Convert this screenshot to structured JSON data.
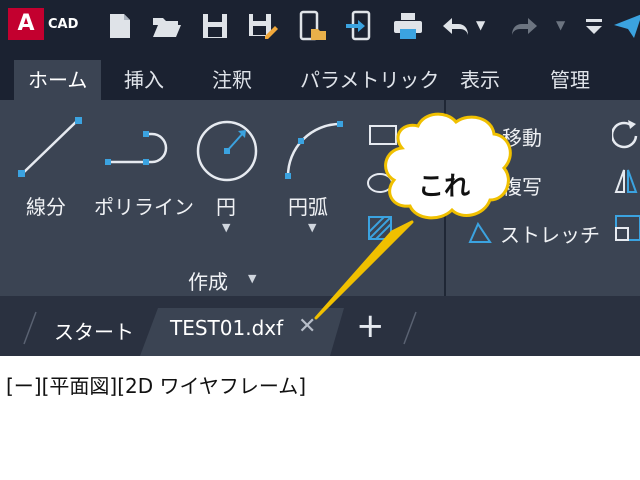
{
  "app": {
    "logo_letter": "A",
    "logo_text": "CAD"
  },
  "quick_access": {
    "icons": [
      "new-file-icon",
      "open-folder-icon",
      "save-icon",
      "save-as-icon",
      "open-from-device-icon",
      "export-to-device-icon",
      "print-icon",
      "undo-icon",
      "redo-icon",
      "customize-icon",
      "send-icon"
    ]
  },
  "ribbon_tabs": [
    {
      "label": "ホーム",
      "active": true
    },
    {
      "label": "挿入",
      "active": false
    },
    {
      "label": "注釈",
      "active": false
    },
    {
      "label": "パラメトリック",
      "active": false
    },
    {
      "label": "表示",
      "active": false
    },
    {
      "label": "管理",
      "active": false
    }
  ],
  "create_panel": {
    "tools": [
      "線分",
      "ポリライン",
      "円",
      "円弧"
    ],
    "panel_title": "作成"
  },
  "modify_panel": {
    "tools": [
      "移動",
      "複写",
      "ストレッチ"
    ]
  },
  "document_tabs": {
    "start": "スタート",
    "active_file": "TEST01.dxf",
    "close_glyph": "✕",
    "new_tab_glyph": "+"
  },
  "viewport": {
    "label": "[ー][平面図][2D ワイヤフレーム]"
  },
  "callout": {
    "text": "これ"
  },
  "colors": {
    "accent_red": "#c3002f",
    "qat_bg": "#1b2231",
    "ribbon_bg": "#3b4453",
    "tabstrip_bg": "#2a3140",
    "callout_line": "#f0c000"
  }
}
